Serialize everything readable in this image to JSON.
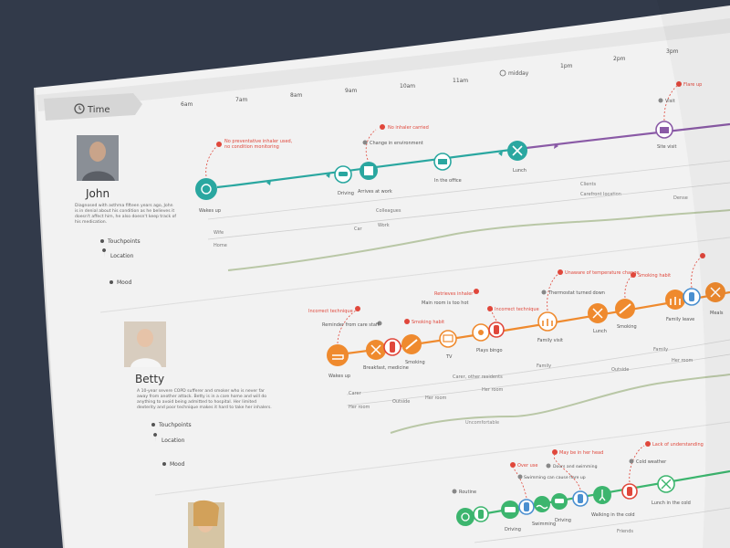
{
  "header": {
    "time_label": "Time",
    "hours": [
      "6am",
      "7am",
      "8am",
      "9am",
      "10am",
      "11am",
      "midday",
      "1pm",
      "2pm",
      "3pm"
    ]
  },
  "common": {
    "touchpoints": "Touchpoints",
    "location": "Location",
    "mood": "Mood"
  },
  "colors": {
    "background": "#323a4a",
    "paper": "#f2f2f2",
    "teal": "#2aa7a0",
    "purple": "#8a5aa6",
    "orange": "#ef8a2e",
    "blue": "#4a8fd0",
    "green": "#3cb56e",
    "red": "#e0473b",
    "mood_line": "#b9c7a6"
  },
  "personas": [
    {
      "name": "John",
      "bio": [
        "Diagnosed with asthma fifteen years ago, John",
        "is in denial about his condition as he believes it",
        "doesn't affect him, he also doesn't keep track of",
        "his medication."
      ],
      "events": [
        "Wakes up",
        "Driving",
        "Arrives at work",
        "In the office",
        "Lunch",
        "Site visit"
      ],
      "alerts": [
        [
          "No preventative inhaler used,",
          "no condition monitoring"
        ],
        [
          "No inhaler carried"
        ],
        [
          "Flare up"
        ]
      ],
      "notes": [
        "Change in environment",
        "Visit"
      ],
      "touchpoints": [
        "Colleagues",
        "Clients",
        "Carefront location"
      ],
      "locations": [
        "Wife",
        "Home",
        "Car",
        "Work",
        "Dense"
      ]
    },
    {
      "name": "Betty",
      "bio": [
        "A 10-year severe COPD sufferer and smoker who is never far",
        "away from another attack. Betty is in a care home and will do",
        "anything to avoid being admitted to hospital. Her limited",
        "dexterity and poor technique makes it hard to take her inhalers."
      ],
      "events": [
        "Wakes up",
        "Breakfast, medicine",
        "Smoking",
        "TV",
        "Plays bingo",
        "Family visit",
        "Lunch",
        "Smoking",
        "Family leave",
        "Meals"
      ],
      "alerts": [
        [
          "Incorrect technique"
        ],
        [
          "Smoking habit"
        ],
        [
          "Retrieves inhaler"
        ],
        [
          "Incorrect technique"
        ],
        [
          "Unaware of temperature change"
        ],
        [
          "Smoking habit"
        ]
      ],
      "notes": [
        "Reminder from care staff",
        "Main room is too hot",
        "Thermostat turned down"
      ],
      "touchpoints": [
        "Carer",
        "Carer, other residents",
        "Family",
        "Family"
      ],
      "locations": [
        "Her room",
        "Outside",
        "Her room",
        "Her room",
        "Outside",
        "Her room"
      ],
      "mood_label": "Uncomfortable"
    },
    {
      "events": [
        "Routine",
        "Driving",
        "Swimming",
        "Driving",
        "Walking in the cold",
        "Lunch in the cold"
      ],
      "alerts": [
        [
          "Over use"
        ],
        [
          "May be in her head"
        ],
        [
          "Lack of understanding"
        ]
      ],
      "notes": [
        "Swimming can cause flare up",
        "Doors and swimming",
        "Cold weather"
      ],
      "touchpoints": [
        "Friends"
      ]
    }
  ]
}
